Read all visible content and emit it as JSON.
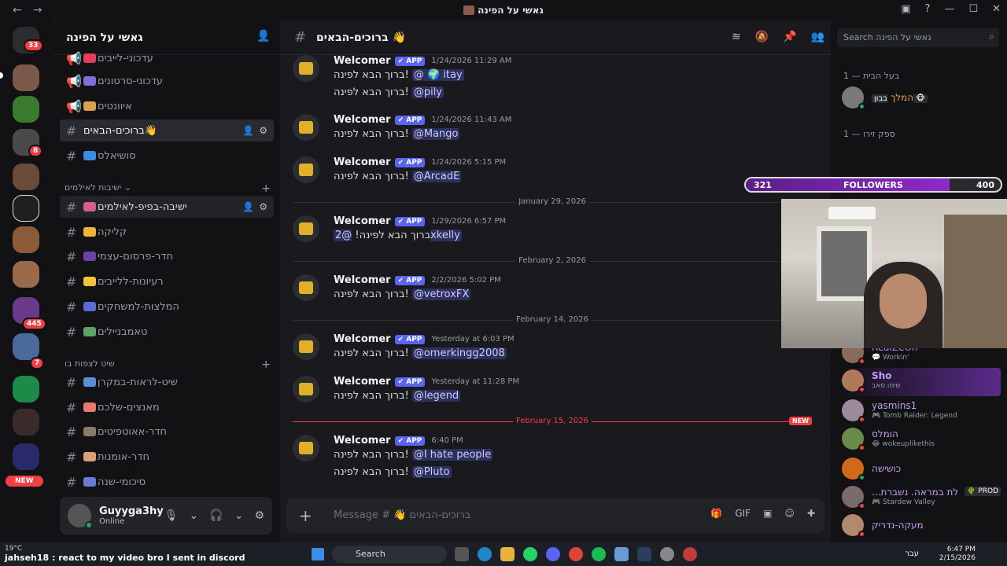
{
  "window": {
    "title": "גאשי על הפינה"
  },
  "rail": {
    "home_badge": "33",
    "badges": [
      "8",
      "445",
      "7"
    ],
    "new_label": "NEW"
  },
  "server": {
    "name": "גאשי על הפינה"
  },
  "channels": [
    {
      "name": "עדכוני-לייבים",
      "emoji_color": "#e33e5c"
    },
    {
      "name": "עדכוני-סרטונים",
      "emoji_color": "#7e6fd6"
    },
    {
      "name": "איוונטים",
      "emoji_color": "#d7a14a"
    },
    {
      "name": "ברוכים-הבאים👋",
      "emoji_color": "#f5c04a"
    },
    {
      "name": "סושיאלס",
      "emoji_color": "#3b8de0"
    }
  ],
  "categories": [
    {
      "name": "ישיבות לאילמים"
    },
    {
      "name": "שיט לצפות בו"
    }
  ],
  "channels2": [
    {
      "name": "ישיבה-בפיפ-לאילמים",
      "emoji_color": "#d85c8e"
    },
    {
      "name": "קליקה",
      "emoji_color": "#f0b23a"
    },
    {
      "name": "חדר-פרסום-עצמי",
      "emoji_color": "#6d3fa8"
    },
    {
      "name": "רעיונות-ללייבים",
      "emoji_color": "#f2c23a"
    },
    {
      "name": "המלצות-למשחקים",
      "emoji_color": "#5b6bd6"
    },
    {
      "name": "טאמבניילים",
      "emoji_color": "#5aa46a"
    }
  ],
  "channels3": [
    {
      "name": "שיט-לראות-במקרן",
      "emoji_color": "#5a8fd6"
    },
    {
      "name": "מאנצים-שלכם",
      "emoji_color": "#e87a6a"
    },
    {
      "name": "חדר-אאוטפיטים",
      "emoji_color": "#8a7a6a"
    },
    {
      "name": "חדר-אומנות",
      "emoji_color": "#d9a07a"
    },
    {
      "name": "סיכומי-שנה",
      "emoji_color": "#6a7ad6"
    }
  ],
  "user": {
    "name": "Guyyga3hy",
    "status": "Online"
  },
  "chat": {
    "channel_name": "ברוכים-הבאים 👋",
    "placeholder": "Message # 👋 ברוכים-הבאים",
    "welcome_text": "ברוך הבא לפינה!",
    "bot_name": "Welcomer",
    "app_label": "✔ APP",
    "messages": [
      {
        "time": "1/24/2026 11:29 AM",
        "lines": [
          "@ 🌍 itay",
          "@pily"
        ]
      },
      {
        "time": "1/24/2026 11:43 AM",
        "lines": [
          "@Mango"
        ]
      },
      {
        "time": "1/24/2026 5:15 PM",
        "lines": [
          "@ArcadE"
        ]
      },
      {
        "time": "1/29/2026 6:57 PM",
        "lines": [
          "@2xkelly"
        ]
      },
      {
        "time": "2/2/2026 5:02 PM",
        "lines": [
          "@vetroxFX"
        ]
      },
      {
        "time": "Yesterday at 6:03 PM",
        "lines": [
          "@omerkingg2008"
        ]
      },
      {
        "time": "Yesterday at 11:28 PM",
        "lines": [
          "@legend"
        ]
      },
      {
        "time": "6:40 PM",
        "lines": [
          "@I hate people",
          "@Pluto"
        ]
      }
    ],
    "dividers": [
      "January 29, 2026",
      "February 2, 2026",
      "February 14, 2026",
      "February 15, 2026"
    ],
    "new_tag": "NEW"
  },
  "members": {
    "search_placeholder": "Search גאשי על הפינה",
    "cat1": "בעל הבית — 1",
    "cat2": "ספק זירו — 1",
    "owner": {
      "name": "המלך",
      "tag": "בבון 🐵"
    },
    "list": [
      {
        "name": "RealZeOn",
        "sub": "💬 Workin'",
        "status": "#f23f43"
      },
      {
        "name": "Sho",
        "sub": "שימו סאב",
        "status": "#f23f43"
      },
      {
        "name": "yasmins1",
        "sub": "🎮 Tomb Raider: Legend",
        "status": "#f23f43"
      },
      {
        "name": "הומלס",
        "sub": "😂 wokeuplikethis",
        "status": "#f23f43"
      },
      {
        "name": "כושישה",
        "sub": "",
        "status": "#23a55a"
      },
      {
        "name": "...לת במראה. נשברת",
        "sub": "🎮 Stardew Valley",
        "tag": "🌵 PROD",
        "status": "#f23f43"
      },
      {
        "name": "מעקה-נדריק",
        "sub": "",
        "status": "#f23f43"
      }
    ]
  },
  "followers": {
    "current": 321,
    "goal": 400,
    "label": "FOLLOWERS",
    "progress": 0.8
  },
  "taskbar": {
    "weather": "19°C",
    "chat_line": "jahseh18 : react to my video bro I sent in discord",
    "search": "Search",
    "lang": "עבר",
    "time": "6:47 PM",
    "date": "2/15/2026"
  },
  "colors": {
    "accent": "#5865f2",
    "online": "#23a55a",
    "dnd": "#f23f43",
    "new": "#f23f43"
  }
}
